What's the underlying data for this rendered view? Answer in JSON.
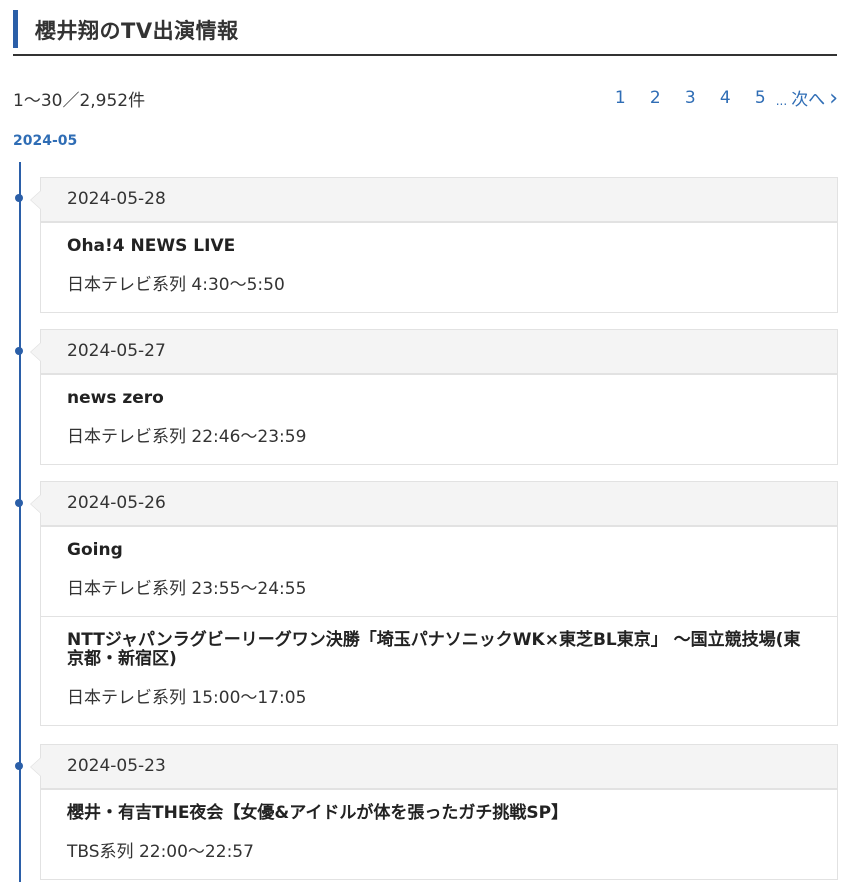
{
  "header": {
    "title": "櫻井翔のTV出演情報"
  },
  "result_count": "1〜30／2,952件",
  "pager": {
    "pages": [
      "1",
      "2",
      "3",
      "4",
      "5"
    ],
    "ellipsis": "...",
    "next_label": "次へ"
  },
  "month": "2024-05",
  "days": [
    {
      "date": "2024-05-28",
      "programs": [
        {
          "title": "Oha!4 NEWS LIVE",
          "meta": "日本テレビ系列 4:30〜5:50"
        }
      ]
    },
    {
      "date": "2024-05-27",
      "programs": [
        {
          "title": "news zero",
          "meta": "日本テレビ系列 22:46〜23:59"
        }
      ]
    },
    {
      "date": "2024-05-26",
      "programs": [
        {
          "title": "Going",
          "meta": "日本テレビ系列 23:55〜24:55"
        },
        {
          "title": "NTTジャパンラグビーリーグワン決勝「埼玉パナソニックWK×東芝BL東京」 〜国立競技場(東京都・新宿区)",
          "meta": "日本テレビ系列 15:00〜17:05"
        }
      ]
    },
    {
      "date": "2024-05-23",
      "programs": [
        {
          "title": "櫻井・有吉THE夜会【女優&アイドルが体を張ったガチ挑戦SP】",
          "meta": "TBS系列 22:00〜22:57"
        }
      ]
    }
  ]
}
